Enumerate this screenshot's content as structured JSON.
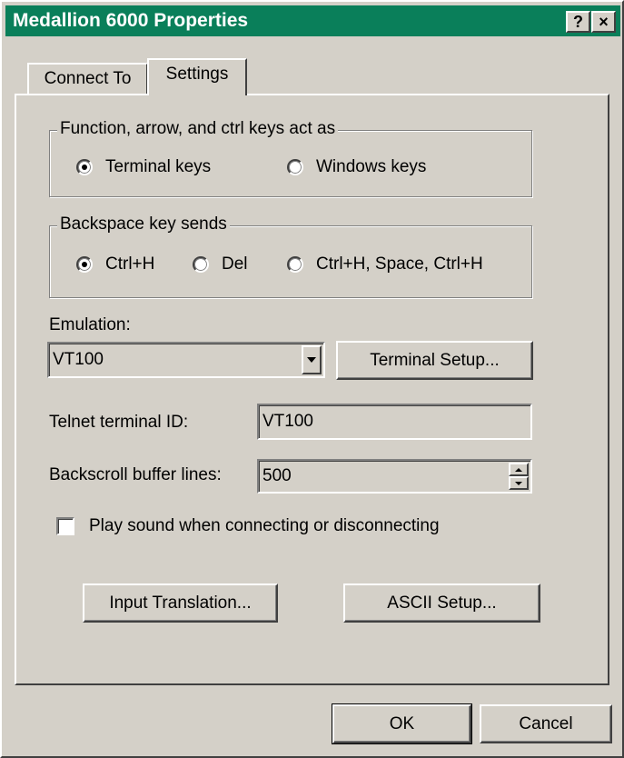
{
  "window": {
    "title": "Medallion 6000 Properties",
    "help_label": "?",
    "close_label": "×",
    "title_bar_color": "#0a7f5a"
  },
  "tabs": [
    {
      "label": "Connect To",
      "selected": false
    },
    {
      "label": "Settings",
      "selected": true
    }
  ],
  "settings": {
    "keys_group": {
      "legend": "Function, arrow, and ctrl keys act as",
      "options": [
        {
          "label": "Terminal keys",
          "selected": true
        },
        {
          "label": "Windows keys",
          "selected": false
        }
      ]
    },
    "backspace_group": {
      "legend": "Backspace key sends",
      "options": [
        {
          "label": "Ctrl+H",
          "selected": true
        },
        {
          "label": "Del",
          "selected": false
        },
        {
          "label": "Ctrl+H, Space, Ctrl+H",
          "selected": false
        }
      ]
    },
    "emulation": {
      "label": "Emulation:",
      "value": "VT100",
      "terminal_setup_label": "Terminal Setup..."
    },
    "telnet_id": {
      "label": "Telnet terminal ID:",
      "value": "VT100"
    },
    "backscroll": {
      "label": "Backscroll buffer lines:",
      "value": "500"
    },
    "play_sound": {
      "label": "Play sound when connecting or disconnecting",
      "checked": false
    },
    "input_translation_label": "Input Translation...",
    "ascii_setup_label": "ASCII Setup..."
  },
  "footer": {
    "ok_label": "OK",
    "cancel_label": "Cancel"
  }
}
